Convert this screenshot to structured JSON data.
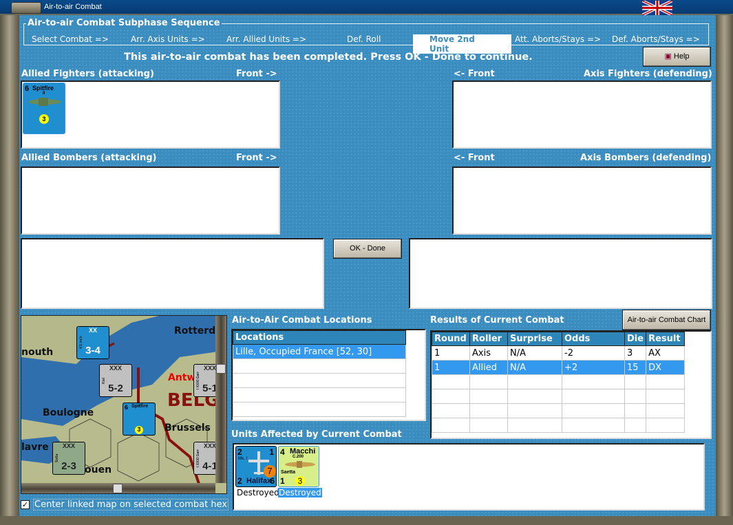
{
  "window": {
    "title": "Air-to-air Combat"
  },
  "sequence": {
    "title": "Air-to-air Combat Subphase Sequence",
    "steps": [
      "Select Combat =>",
      "Arr. Axis Units =>",
      "Arr. Allied Units =>",
      "Def. Roll",
      "Move 2nd Unit",
      "Att. Aborts/Stays =>",
      "Def. Aborts/Stays =>"
    ],
    "active_index": 4
  },
  "message": "This air-to-air combat has been completed.  Press OK - Done to continue.",
  "help_label": "Help",
  "panels": {
    "allied_fighters": "Allied Fighters (attacking)",
    "allied_bombers": "Allied Bombers (attacking)",
    "axis_fighters": "Axis Fighters (defending)",
    "axis_bombers": "Axis Bombers (defending)",
    "front_right": "Front ->",
    "front_left": "<- Front"
  },
  "allied_fighter_unit": {
    "name": "Spitfire",
    "mark": "II",
    "air_to_air": "6",
    "range": "3"
  },
  "ok_label": "OK - Done",
  "locations": {
    "title": "Air-to-Air Combat Locations",
    "header": "Locations",
    "rows": [
      "Lille, Occupied France [52, 30]"
    ]
  },
  "results": {
    "title": "Results of Current Combat",
    "chart_button": "Air-to-air Combat Chart",
    "columns": [
      "Round",
      "Roller",
      "Surprise",
      "Odds",
      "Die",
      "Result"
    ],
    "rows": [
      [
        "1",
        "Axis",
        "N/A",
        "-2",
        "3",
        "AX"
      ],
      [
        "1",
        "Allied",
        "N/A",
        "+2",
        "15",
        "DX"
      ]
    ],
    "selected_row": 1
  },
  "affected": {
    "title": "Units Affected by Current Combat",
    "units": [
      {
        "name": "Halifax",
        "mark": "Mk. I",
        "tl": "2",
        "tr": "1",
        "bl": "2",
        "br": "6",
        "circle": "7",
        "status": "Destroyed"
      },
      {
        "name": "Macchi",
        "model": "C.200",
        "sub": "Saetta",
        "tl": "4",
        "bl": "1",
        "circle": "3",
        "status": "Destroyed"
      }
    ]
  },
  "map": {
    "labels": [
      "nouth",
      "Rotterda",
      "Antw",
      "BELG",
      "Boulogne",
      "Brussels",
      "lavre",
      "ouen"
    ],
    "counters": [
      {
        "top": "XX",
        "side": "4.5 inch",
        "value": "3-4"
      },
      {
        "top": "XXX",
        "side": "Kiel",
        "value": "5-2"
      },
      {
        "top": "XXX",
        "side": "I XXXI Garr",
        "value": "5-1"
      },
      {
        "top": "XXX",
        "side": "Sofia",
        "value": "2-3"
      },
      {
        "top": "XXX",
        "side": "I XXXI Garr",
        "value": "4-1"
      }
    ]
  },
  "center_map": {
    "label": "Center linked map on selected combat hex",
    "checked": true
  },
  "colors": {
    "panel": "#3b8cbf",
    "header": "#2e86b8",
    "selected": "#3399ee"
  }
}
